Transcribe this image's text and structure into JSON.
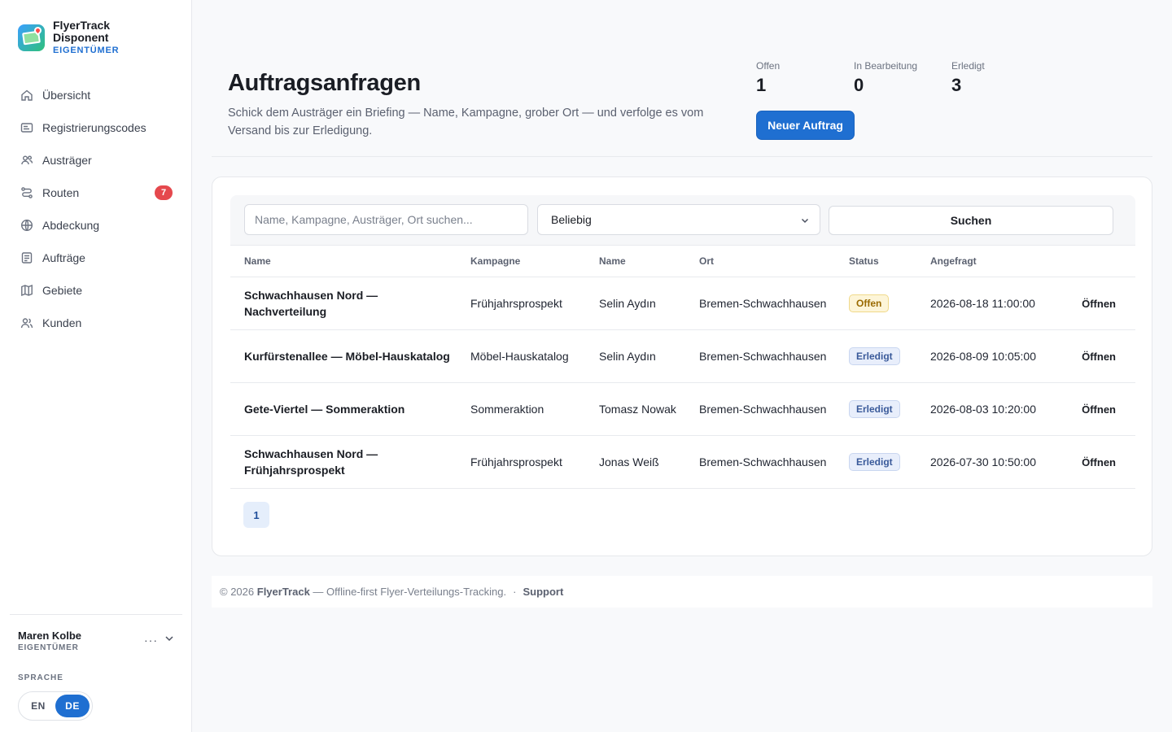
{
  "brand": {
    "line1": "FlyerTrack",
    "line2": "Disponent",
    "role": "EIGENTÜMER"
  },
  "nav": [
    {
      "label": "Übersicht",
      "icon": "home-icon"
    },
    {
      "label": "Registrierungscodes",
      "icon": "id-card-icon"
    },
    {
      "label": "Austräger",
      "icon": "users-icon"
    },
    {
      "label": "Routen",
      "icon": "route-icon",
      "badge": "7"
    },
    {
      "label": "Abdeckung",
      "icon": "globe-icon"
    },
    {
      "label": "Aufträge",
      "icon": "document-icon"
    },
    {
      "label": "Gebiete",
      "icon": "map-icon"
    },
    {
      "label": "Kunden",
      "icon": "customers-icon"
    }
  ],
  "user": {
    "name": "Maren Kolbe",
    "role": "EIGENTÜMER",
    "more": "···"
  },
  "language": {
    "title": "SPRACHE",
    "options": [
      "EN",
      "DE"
    ],
    "active": "DE"
  },
  "header": {
    "title": "Auftragsanfragen",
    "subtitle": "Schick dem Austräger ein Briefing — Name, Kampagne, grober Ort — und verfolge es vom Versand bis zur Erledigung.",
    "stats": [
      {
        "label": "Offen",
        "value": "1"
      },
      {
        "label": "In Bearbeitung",
        "value": "0"
      },
      {
        "label": "Erledigt",
        "value": "3"
      }
    ],
    "new_button": "Neuer Auftrag"
  },
  "filters": {
    "search_placeholder": "Name, Kampagne, Austräger, Ort suchen...",
    "status_selected": "Beliebig",
    "search_button": "Suchen"
  },
  "table": {
    "columns": [
      "Name",
      "Kampagne",
      "Name",
      "Ort",
      "Status",
      "Angefragt"
    ],
    "rows": [
      {
        "name": "Schwachhausen Nord — Nachverteilung",
        "campaign": "Frühjahrsprospekt",
        "person": "Selin Aydın",
        "ort": "Bremen-Schwachhausen",
        "status": "Offen",
        "status_kind": "offen",
        "requested": "2026-08-18 11:00:00",
        "action": "Öffnen"
      },
      {
        "name": "Kurfürstenallee — Möbel-Hauskatalog",
        "campaign": "Möbel-Hauskatalog",
        "person": "Selin Aydın",
        "ort": "Bremen-Schwachhausen",
        "status": "Erledigt",
        "status_kind": "erledigt",
        "requested": "2026-08-09 10:05:00",
        "action": "Öffnen"
      },
      {
        "name": "Gete-Viertel — Sommeraktion",
        "campaign": "Sommeraktion",
        "person": "Tomasz Nowak",
        "ort": "Bremen-Schwachhausen",
        "status": "Erledigt",
        "status_kind": "erledigt",
        "requested": "2026-08-03 10:20:00",
        "action": "Öffnen"
      },
      {
        "name": "Schwachhausen Nord — Frühjahrsprospekt",
        "campaign": "Frühjahrsprospekt",
        "person": "Jonas Weiß",
        "ort": "Bremen-Schwachhausen",
        "status": "Erledigt",
        "status_kind": "erledigt",
        "requested": "2026-07-30 10:50:00",
        "action": "Öffnen"
      }
    ]
  },
  "pagination": {
    "current": "1"
  },
  "footer": {
    "prefix": "© 2026",
    "brand": "FlyerTrack",
    "text": "— Offline-first Flyer-Verteilungs-Tracking.",
    "separator": "·",
    "link": "Support"
  },
  "colors": {
    "accent": "#1f6fd1",
    "badge_red": "#e5484d",
    "status_open": "#9a6a00",
    "status_done": "#3a5a9a"
  }
}
